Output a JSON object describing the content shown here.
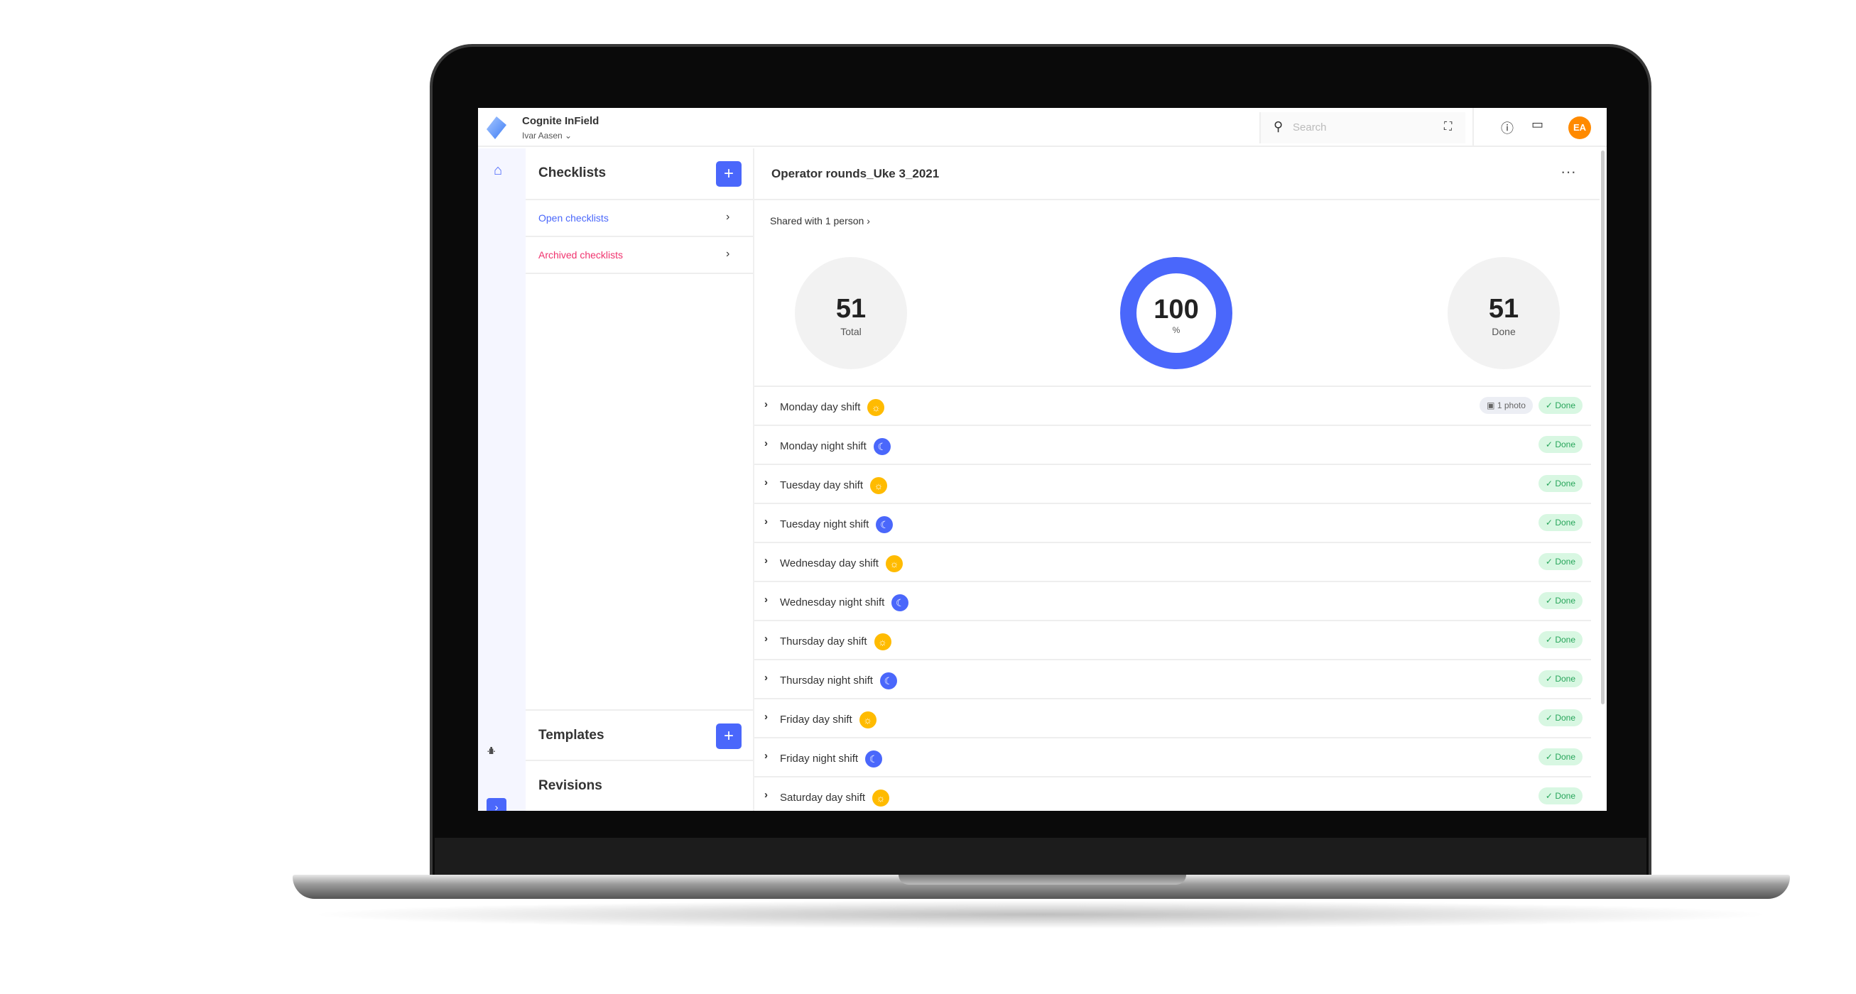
{
  "header": {
    "app_title": "Cognite InField",
    "user": "Ivar Aasen",
    "search_placeholder": "Search",
    "avatar": "EA"
  },
  "colors": {
    "accent": "#4a67fb",
    "open_link": "#4a67fb",
    "archived_link": "#f0336e",
    "done": "#27a55a",
    "day": "#ffbb00",
    "avatar": "#ff8a00"
  },
  "sidebar": {
    "checklists_title": "Checklists",
    "open_label": "Open checklists",
    "archived_label": "Archived checklists",
    "templates_title": "Templates",
    "revisions_title": "Revisions"
  },
  "main": {
    "title": "Operator rounds_Uke 3_2021",
    "shared": "Shared with 1 person",
    "stats": {
      "total": "51",
      "total_label": "Total",
      "percent": "100",
      "percent_label": "%",
      "percent_value": 100,
      "done": "51",
      "done_label": "Done"
    },
    "rows": [
      {
        "name": "Monday day shift",
        "shift": "day",
        "photo": "1 photo",
        "status": "Done"
      },
      {
        "name": "Monday night shift",
        "shift": "night",
        "status": "Done"
      },
      {
        "name": "Tuesday day shift",
        "shift": "day",
        "status": "Done"
      },
      {
        "name": "Tuesday night shift",
        "shift": "night",
        "status": "Done"
      },
      {
        "name": "Wednesday day shift",
        "shift": "day",
        "status": "Done"
      },
      {
        "name": "Wednesday night shift",
        "shift": "night",
        "status": "Done"
      },
      {
        "name": "Thursday day shift",
        "shift": "day",
        "status": "Done"
      },
      {
        "name": "Thursday night shift",
        "shift": "night",
        "status": "Done"
      },
      {
        "name": "Friday day shift",
        "shift": "day",
        "status": "Done"
      },
      {
        "name": "Friday night shift",
        "shift": "night",
        "status": "Done"
      },
      {
        "name": "Saturday day shift",
        "shift": "day",
        "status": "Done"
      }
    ]
  }
}
